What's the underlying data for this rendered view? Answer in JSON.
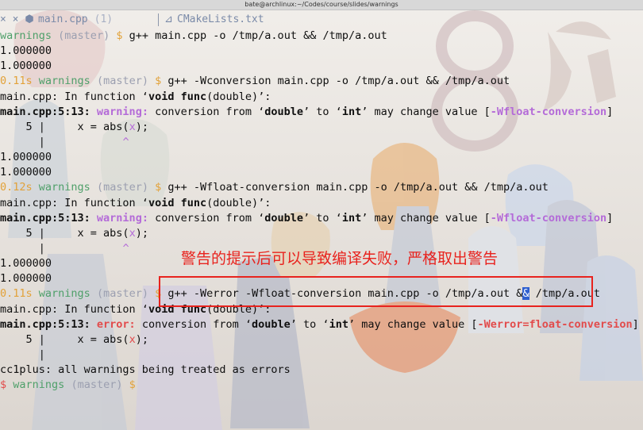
{
  "window": {
    "title": "bate@archlinux:~/Codes/course/slides/warnings"
  },
  "tabs": [
    {
      "icon": "cpp-file-icon",
      "label": "main.cpp",
      "count": "(1)"
    },
    {
      "icon": "cmake-file-icon",
      "label": "CMakeLists.txt"
    }
  ],
  "terminal": {
    "l1": {
      "dir": "warnings",
      "branch": "(master)",
      "dollar": "$",
      "cmd": "g++ main.cpp -o /tmp/a.out && /tmp/a.out"
    },
    "l2": "1.000000",
    "l3": "1.000000",
    "l4": {
      "time": "0.11s",
      "dir": "warnings",
      "branch": "(master)",
      "dollar": "$",
      "cmd": "g++ -Wconversion main.cpp -o /tmp/a.out && /tmp/a.out"
    },
    "l5": {
      "a": "main.cpp: In function ‘",
      "b": "void",
      "c": " ",
      "d": "func",
      "e": "(double)’:"
    },
    "l6": {
      "loc": "main.cpp:5:13: ",
      "kind": "warning:",
      "m1": " conversion from ‘",
      "t1": "double",
      "m2": "’ to ‘",
      "t2": "int",
      "m3": "’ may change value [",
      "flag": "-Wfloat-conversion",
      "m4": "]"
    },
    "l7": {
      "gut": "    5 |     x = ",
      "f": "abs(",
      "hl": "x",
      "end": ");"
    },
    "l8": {
      "gut": "      |",
      "sp": "            ",
      "caret": "^"
    },
    "l9": "1.000000",
    "l10": "1.000000",
    "l11": {
      "time": "0.12s",
      "dir": "warnings",
      "branch": "(master)",
      "dollar": "$",
      "cmd": "g++ -Wfloat-conversion main.cpp -o /tmp/a.out && /tmp/a.out"
    },
    "l12": {
      "a": "main.cpp: In function ‘",
      "b": "void",
      "c": " ",
      "d": "func",
      "e": "(double)’:"
    },
    "l13": {
      "loc": "main.cpp:5:13: ",
      "kind": "warning:",
      "m1": " conversion from ‘",
      "t1": "double",
      "m2": "’ to ‘",
      "t2": "int",
      "m3": "’ may change value [",
      "flag": "-Wfloat-conversion",
      "m4": "]"
    },
    "l14": {
      "gut": "    5 |     x = ",
      "f": "abs(",
      "hl": "x",
      "end": ");"
    },
    "l15": {
      "gut": "      |",
      "sp": "            ",
      "caret": "^"
    },
    "l16": "1.000000",
    "l17": "1.000000",
    "l18": {
      "time": "0.11s",
      "dir": "warnings",
      "branch": "(master)",
      "dollar": "$",
      "cmd1": "g++ -Werror -Wfloat-conversion main.cpp -o /tmp/a.out &",
      "cursor": "&",
      "cmd2": " /tmp/a.out"
    },
    "l19": {
      "a": "main.cpp: In function ‘",
      "b": "void",
      "c": " ",
      "d": "func",
      "e": "(double)’:"
    },
    "l20": {
      "loc": "main.cpp:5:13: ",
      "kind": "error:",
      "m1": " conversion from ‘",
      "t1": "double",
      "m2": "’ to ‘",
      "t2": "int",
      "m3": "’ may change value [",
      "flag": "-Werror=float-conversion",
      "m4": "]"
    },
    "l21": {
      "gut": "    5 |     x = ",
      "f": "abs(",
      "hl": "x",
      "end": ");"
    },
    "l22": {
      "gut": "      |"
    },
    "l23": "cc1plus: all warnings being treated as errors",
    "l24": {
      "dollar": "$",
      "dir": "warnings",
      "branch": "(master)",
      "prompt": "$"
    }
  },
  "annotation": {
    "text": "警告的提示后可以导致编译失败，严格取出警告"
  },
  "colors": {
    "prompt_green": "#4fa06a",
    "branch_gray": "#9b9fb0",
    "timing_yellow": "#e2a23a",
    "warning_purple": "#b46bd8",
    "error_red": "#e24b4b",
    "annotation_red": "#e8231e"
  }
}
